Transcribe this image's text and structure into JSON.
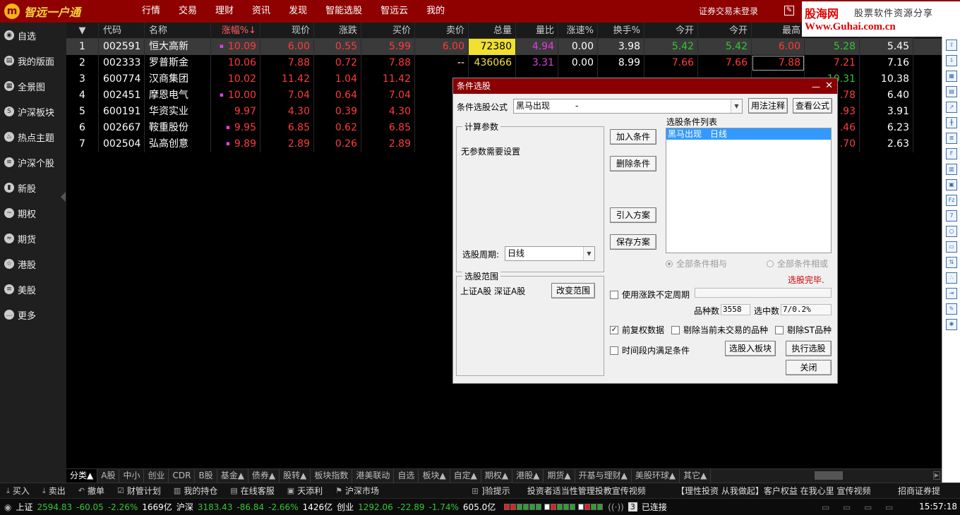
{
  "app": {
    "logo_mark": "m",
    "logo_text": "智远一户通",
    "nav": [
      "行情",
      "交易",
      "理财",
      "资讯",
      "发现",
      "智能选股",
      "智远云",
      "我的"
    ],
    "login_status": "证券交易未登录"
  },
  "watermark": {
    "line1": "股海网",
    "line2": "股票软件资源分享",
    "line3": "Www.Guhai.com.cn"
  },
  "sidebar": {
    "items": [
      {
        "label": "自选",
        "icon": "eye-icon"
      },
      {
        "label": "我的版面",
        "icon": "layout-icon"
      },
      {
        "label": "全景图",
        "icon": "panorama-icon"
      },
      {
        "label": "沪深板块",
        "icon": "sector-icon"
      },
      {
        "label": "热点主题",
        "icon": "flame-icon"
      },
      {
        "label": "沪深个股",
        "icon": "signal-icon"
      },
      {
        "label": "新股",
        "icon": "bar-chart-icon"
      },
      {
        "label": "期权",
        "icon": "options-icon"
      },
      {
        "label": "期货",
        "icon": "futures-icon"
      },
      {
        "label": "港股",
        "icon": "star-icon"
      },
      {
        "label": "美股",
        "icon": "list-icon"
      },
      {
        "label": "更多",
        "icon": "more-icon"
      }
    ]
  },
  "grid": {
    "headers": [
      "▼",
      "代码",
      "名称",
      "涨幅%↓",
      "现价",
      "涨跌",
      "买价",
      "卖价",
      "总量",
      "量比",
      "涨速%",
      "换手%",
      "今开",
      "今开",
      "最高",
      "",
      ""
    ],
    "rows": [
      {
        "n": "1",
        "code": "002591",
        "name": "恒大高新",
        "mark": true,
        "pct": "10.09",
        "price": "6.00",
        "chg": "0.55",
        "bid": "5.99",
        "ask": "6.00",
        "vol": "72380",
        "vr": "4.94",
        "speed": "0.00",
        "turn": "3.98",
        "open": "5.42",
        "open2": "5.42",
        "high": "6.00",
        "c15": "5.28",
        "c16": "5.45"
      },
      {
        "n": "2",
        "code": "002333",
        "name": "罗普斯金",
        "mark": false,
        "pct": "10.06",
        "price": "7.88",
        "chg": "0.72",
        "bid": "7.88",
        "ask": "--",
        "vol": "436066",
        "vr": "3.31",
        "speed": "0.00",
        "turn": "8.99",
        "open": "7.66",
        "open2": "7.66",
        "high": "7.88",
        "c15": "7.21",
        "c16": "7.16"
      },
      {
        "n": "3",
        "code": "600774",
        "name": "汉商集团",
        "mark": false,
        "pct": "10.02",
        "price": "11.42",
        "chg": "1.04",
        "bid": "11.42",
        "ask": "--",
        "vol": "",
        "vr": "",
        "speed": "",
        "turn": "",
        "open": "",
        "open2": "",
        "high": "",
        "c15": "10.31",
        "c16": "10.38"
      },
      {
        "n": "4",
        "code": "002451",
        "name": "摩恩电气",
        "mark": true,
        "pct": "10.00",
        "price": "7.04",
        "chg": "0.64",
        "bid": "7.04",
        "ask": "",
        "vol": "",
        "vr": "",
        "speed": "",
        "turn": "",
        "open": "",
        "open2": "",
        "high": "",
        "c15": ".78",
        "c16": "6.40"
      },
      {
        "n": "5",
        "code": "600191",
        "name": "华资实业",
        "mark": false,
        "pct": "9.97",
        "price": "4.30",
        "chg": "0.39",
        "bid": "4.30",
        "ask": "",
        "vol": "",
        "vr": "",
        "speed": "",
        "turn": "",
        "open": "",
        "open2": "",
        "high": "",
        "c15": ".93",
        "c16": "3.91"
      },
      {
        "n": "6",
        "code": "002667",
        "name": "鞍重股份",
        "mark": true,
        "pct": "9.95",
        "price": "6.85",
        "chg": "0.62",
        "bid": "6.85",
        "ask": "",
        "vol": "",
        "vr": "",
        "speed": "",
        "turn": "",
        "open": "",
        "open2": "",
        "high": "",
        "c15": ".46",
        "c16": "6.23"
      },
      {
        "n": "7",
        "code": "002504",
        "name": "弘高创意",
        "mark": true,
        "pct": "9.89",
        "price": "2.89",
        "chg": "0.26",
        "bid": "2.89",
        "ask": "",
        "vol": "",
        "vr": "",
        "speed": "",
        "turn": "",
        "open": "",
        "open2": "",
        "high": "",
        "c15": ".70",
        "c16": "2.63"
      }
    ]
  },
  "dialog": {
    "title": "条件选股",
    "minimize": "—",
    "close": "✕",
    "formula_label": "条件选股公式",
    "formula_value": "黑马出现　　　-",
    "usage_btn": "用法注释",
    "view_formula_btn": "查看公式",
    "params_group": "计算参数",
    "params_text": "无参数需要设置",
    "period_label": "选股周期:",
    "period_value": "日线",
    "add_btn": "加入条件",
    "delete_btn": "删除条件",
    "import_btn": "引入方案",
    "save_btn": "保存方案",
    "list_label": "选股条件列表",
    "list_items": [
      "黑马出现　日线"
    ],
    "radio_and": "全部条件相与",
    "radio_or": "全部条件相或",
    "done_text": "选股完毕.",
    "scope_group": "选股范围",
    "scope_text": "上证A股 深证A股",
    "change_scope_btn": "改变范围",
    "use_variable_period": "使用涨跌不定周期",
    "count_label": "品种数",
    "count_value": "3558",
    "selected_label": "选中数",
    "selected_value": "7/0.2%",
    "adj_data": "前复权数据",
    "exclude_untraded": "剔除当前未交易的品种",
    "exclude_st": "剔除ST品种",
    "within_period": "时间段内满足条件",
    "to_block_btn": "选股入板块",
    "run_btn": "执行选股",
    "close_btn": "关闭"
  },
  "tabs": [
    "分类▲",
    "A股",
    "中小",
    "创业",
    "CDR",
    "B股",
    "基金▲",
    "债券▲",
    "股转▲",
    "板块指数",
    "港美联动",
    "自选",
    "板块▲",
    "自定▲",
    "期权▲",
    "港股▲",
    "期货▲",
    "开基与理财▲",
    "美股环球▲",
    "其它▲"
  ],
  "actions": [
    {
      "label": "买入",
      "icon": "buy-icon"
    },
    {
      "label": "卖出",
      "icon": "sell-icon"
    },
    {
      "label": "撤单",
      "icon": "undo-icon"
    },
    {
      "label": "财管计划",
      "icon": "plan-icon"
    },
    {
      "label": "我的持仓",
      "icon": "holdings-icon"
    },
    {
      "label": "在线客服",
      "icon": "service-icon"
    },
    {
      "label": "天添利",
      "icon": "wallet-icon"
    },
    {
      "label": "沪深市场",
      "icon": "bookmark-icon"
    }
  ],
  "notices": {
    "n1": "]验提示　　投资者适当性管理投教宣传视频",
    "n2": "【理性投资 从我做起】客户权益 在我心里 宣传视频",
    "n3": "招商证券提"
  },
  "status": {
    "sh_label": "上证",
    "sh_val": "2594.83",
    "sh_chg": "-60.05",
    "sh_pct": "-2.26%",
    "sh_amt": "1669亿",
    "hs_label": "沪深",
    "hs_val": "3183.43",
    "hs_chg": "-86.84",
    "hs_pct": "-2.66%",
    "hs_amt": "1426亿",
    "cy_label": "创业",
    "cy_val": "1292.06",
    "cy_chg": "-22.89",
    "cy_pct": "-1.74%",
    "cy_amt": "605.0亿",
    "conn_count": "3",
    "conn_text": "已连接",
    "clock": "15:57:18"
  },
  "colors": {
    "title_bar": "#8f0000",
    "up": "#ff3b3b",
    "down": "#32c832",
    "selection": "#3399ff"
  }
}
